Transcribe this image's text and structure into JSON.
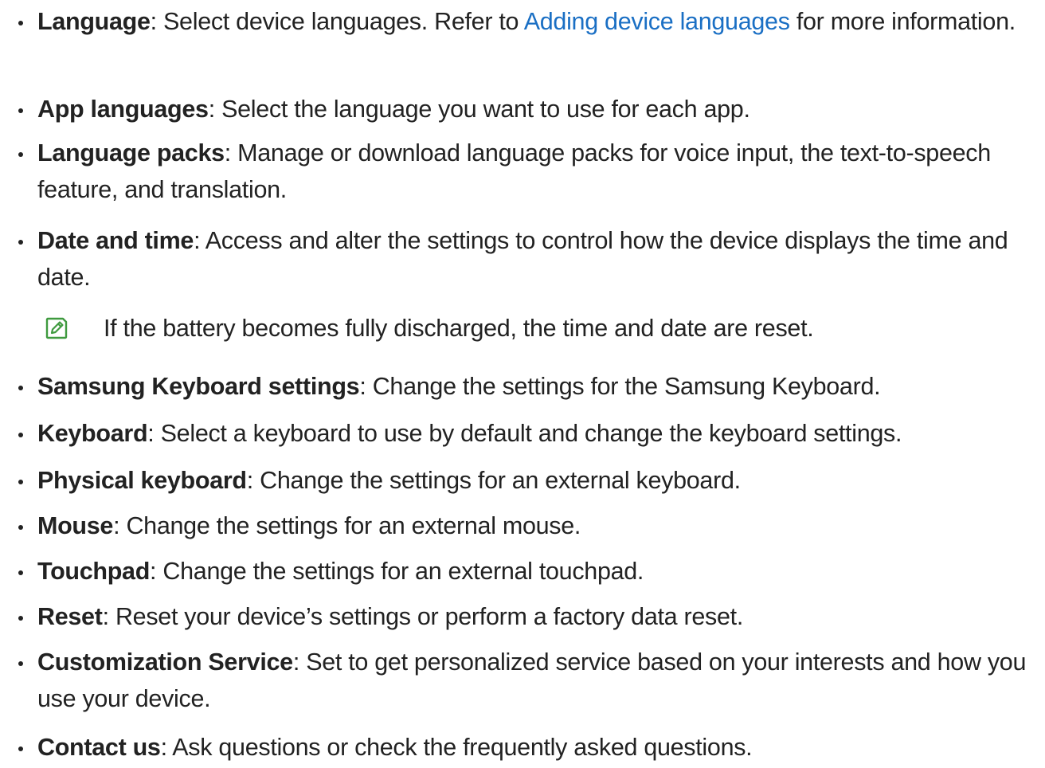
{
  "items": [
    {
      "term": "Language",
      "sep": ": ",
      "before": "Select device languages. Refer to ",
      "link": "Adding device languages",
      "after": " for more information."
    },
    {
      "term": "App languages",
      "sep": ": ",
      "text": "Select the language you want to use for each app."
    },
    {
      "term": "Language packs",
      "sep": ": ",
      "text": "Manage or download language packs for voice input, the text-to-speech feature, and translation."
    },
    {
      "term": "Date and time",
      "sep": ": ",
      "text": "Access and alter the settings to control how the device displays the time and date."
    },
    {
      "term": "Samsung Keyboard settings",
      "sep": ": ",
      "text": "Change the settings for the Samsung Keyboard."
    },
    {
      "term": "Keyboard",
      "sep": ": ",
      "text": "Select a keyboard to use by default and change the keyboard settings."
    },
    {
      "term": "Physical keyboard",
      "sep": ": ",
      "text": "Change the settings for an external keyboard."
    },
    {
      "term": "Mouse",
      "sep": ": ",
      "text": "Change the settings for an external mouse."
    },
    {
      "term": "Touchpad",
      "sep": ": ",
      "text": "Change the settings for an external touchpad."
    },
    {
      "term": "Reset",
      "sep": ": ",
      "text": "Reset your device’s settings or perform a factory data reset."
    },
    {
      "term": "Customization Service",
      "sep": ": ",
      "text": "Set to get personalized service based on your interests and how you use your device."
    },
    {
      "term": "Contact us",
      "sep": ": ",
      "text": "Ask questions or check the frequently asked questions."
    }
  ],
  "note": {
    "icon": "note-pencil-icon",
    "text": "If the battery becomes fully discharged, the time and date are reset."
  },
  "colors": {
    "text": "#222222",
    "link": "#1a6fc4",
    "note_icon": "#3f9a3f"
  }
}
